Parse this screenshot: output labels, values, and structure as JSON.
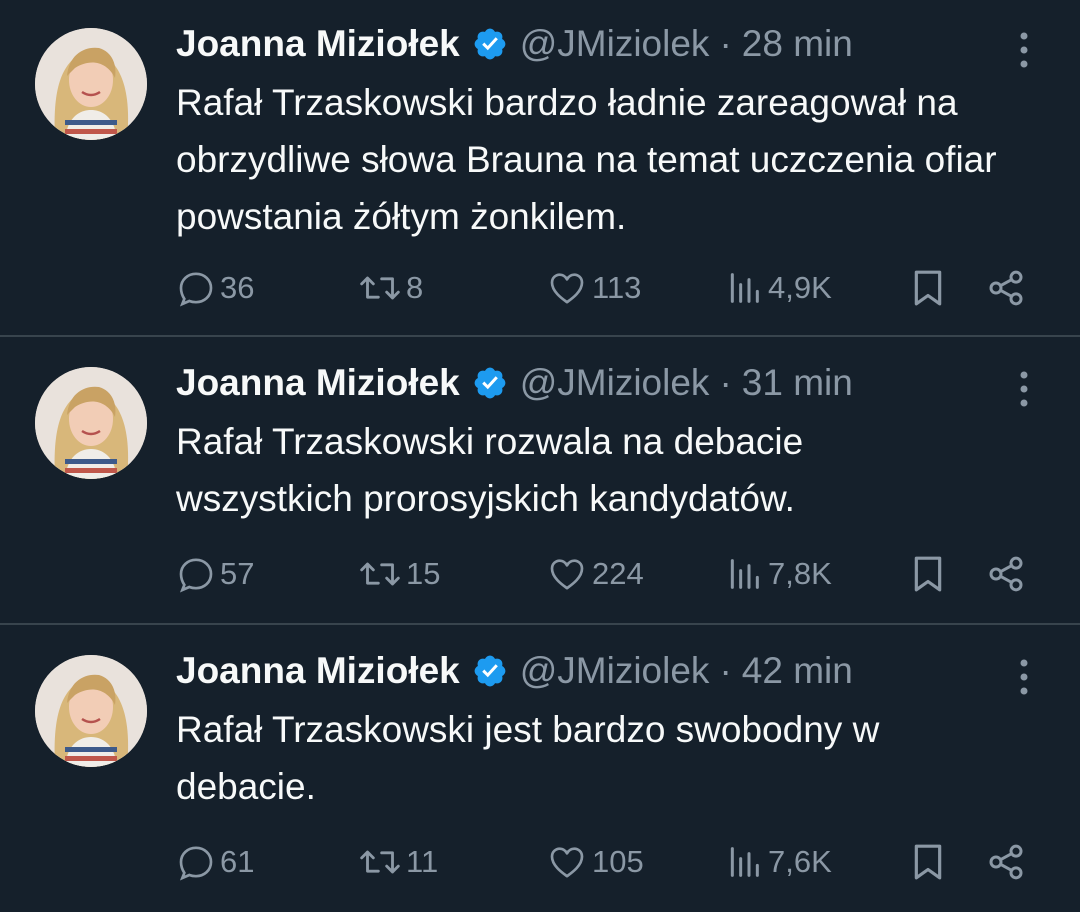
{
  "colors": {
    "background": "#15202b",
    "text_primary": "#f7f9f9",
    "text_secondary": "#8b98a5",
    "divider": "#38444d",
    "verified_badge": "#1d9bf0"
  },
  "tweets": [
    {
      "author_name": "Joanna Miziołek",
      "handle": "@JMiziolek",
      "separator": "·",
      "time": "28 min",
      "text": "Rafał Trzaskowski bardzo ładnie zareagował na obrzydliwe słowa Brauna na temat uczczenia ofiar powstania żółtym żonkilem.",
      "replies": "36",
      "retweets": "8",
      "likes": "113",
      "views": "4,9K",
      "icons": [
        "verified-badge-icon",
        "more-icon",
        "reply-icon",
        "retweet-icon",
        "like-icon",
        "views-icon",
        "bookmark-icon",
        "share-icon"
      ]
    },
    {
      "author_name": "Joanna Miziołek",
      "handle": "@JMiziolek",
      "separator": "·",
      "time": "31 min",
      "text": "Rafał Trzaskowski rozwala na debacie wszystkich prorosyjskich kandydatów.",
      "replies": "57",
      "retweets": "15",
      "likes": "224",
      "views": "7,8K",
      "icons": [
        "verified-badge-icon",
        "more-icon",
        "reply-icon",
        "retweet-icon",
        "like-icon",
        "views-icon",
        "bookmark-icon",
        "share-icon"
      ]
    },
    {
      "author_name": "Joanna Miziołek",
      "handle": "@JMiziolek",
      "separator": "·",
      "time": "42 min",
      "text": "Rafał Trzaskowski jest bardzo swobodny w debacie.",
      "replies": "61",
      "retweets": "11",
      "likes": "105",
      "views": "7,6K",
      "icons": [
        "verified-badge-icon",
        "more-icon",
        "reply-icon",
        "retweet-icon",
        "like-icon",
        "views-icon",
        "bookmark-icon",
        "share-icon"
      ]
    }
  ]
}
